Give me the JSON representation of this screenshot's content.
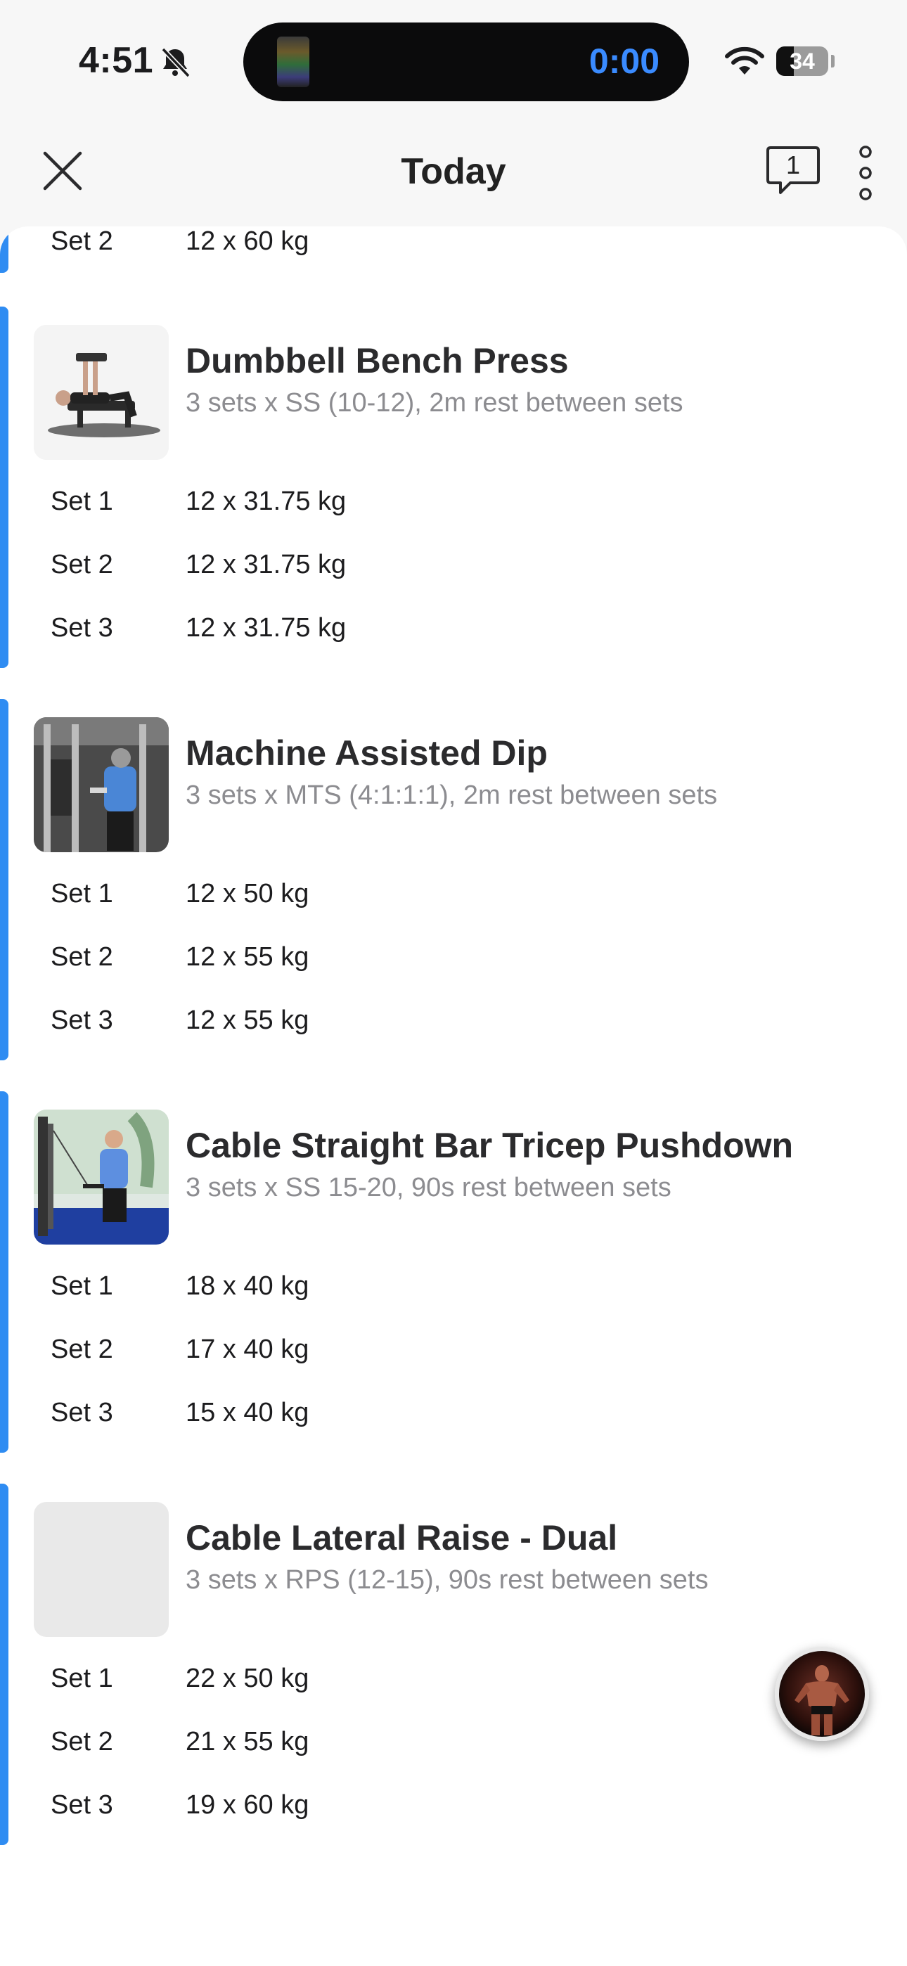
{
  "status_bar": {
    "time": "4:51",
    "timer": "0:00",
    "battery": "34",
    "battery_level_percent": 34
  },
  "nav": {
    "title": "Today",
    "comment_count": "1",
    "icons": [
      "close-icon",
      "comment-icon",
      "more-vertical-icon"
    ]
  },
  "previous_exercise": {
    "sets": [
      {
        "label": "Set 2",
        "value": "12 x 60 kg"
      }
    ]
  },
  "exercises": [
    {
      "name": "Dumbbell Bench Press",
      "description": "3 sets x SS (10-12), 2m rest between sets",
      "sets": [
        {
          "label": "Set 1",
          "value": "12 x 31.75 kg"
        },
        {
          "label": "Set 2",
          "value": "12 x 31.75 kg"
        },
        {
          "label": "Set 3",
          "value": "12 x 31.75 kg"
        }
      ]
    },
    {
      "name": "Machine Assisted Dip",
      "description": "3 sets x MTS (4:1:1:1), 2m rest between sets",
      "sets": [
        {
          "label": "Set 1",
          "value": "12 x 50 kg"
        },
        {
          "label": "Set 2",
          "value": "12 x 55 kg"
        },
        {
          "label": "Set 3",
          "value": "12 x 55 kg"
        }
      ]
    },
    {
      "name": "Cable Straight Bar Tricep Pushdown",
      "description": "3 sets x SS 15-20, 90s rest between sets",
      "sets": [
        {
          "label": "Set 1",
          "value": "18 x 40 kg"
        },
        {
          "label": "Set 2",
          "value": "17 x 40 kg"
        },
        {
          "label": "Set 3",
          "value": "15 x 40 kg"
        }
      ]
    },
    {
      "name": "Cable Lateral Raise - Dual",
      "description": "3 sets x RPS (12-15), 90s rest between sets",
      "sets": [
        {
          "label": "Set 1",
          "value": "22 x 50 kg"
        },
        {
          "label": "Set 2",
          "value": "21 x 55 kg"
        },
        {
          "label": "Set 3",
          "value": "19 x 60 kg"
        }
      ]
    }
  ],
  "colors": {
    "accent": "#2f8cf2",
    "timer": "#3a8bff"
  }
}
